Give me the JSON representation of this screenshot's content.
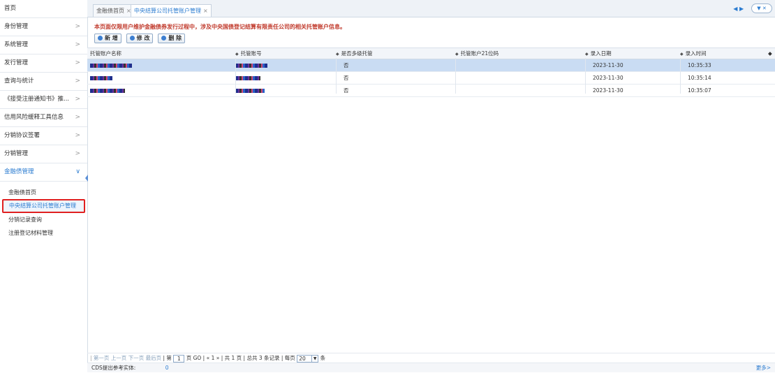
{
  "sidebar": {
    "items": [
      {
        "label": "首页",
        "chevron": ""
      },
      {
        "label": "身份管理",
        "chevron": ">"
      },
      {
        "label": "系统管理",
        "chevron": ">"
      },
      {
        "label": "发行管理",
        "chevron": ">"
      },
      {
        "label": "查询与统计",
        "chevron": ">"
      },
      {
        "label": "《接受注册通知书》推...",
        "chevron": ">"
      },
      {
        "label": "信用风险缓释工具信息",
        "chevron": ">"
      },
      {
        "label": "分销协议签署",
        "chevron": ">"
      },
      {
        "label": "分销管理",
        "chevron": ">"
      },
      {
        "label": "金融债管理",
        "chevron": "∨"
      }
    ],
    "sub_items": [
      {
        "label": "金融债首页"
      },
      {
        "label": "中央结算公司托管账户管理"
      },
      {
        "label": "分销记录查询"
      },
      {
        "label": "注册登记材料管理"
      }
    ]
  },
  "tabs": [
    {
      "label": "金融债首页",
      "close": "×"
    },
    {
      "label": "中央结算公司托管账户管理",
      "close": "×"
    }
  ],
  "tab_nav": {
    "arrows": "◀ ▶",
    "dropdown": "▼ ✕"
  },
  "notice": "本页面仅限用户维护金融债券发行过程中，涉及中央国债登记结算有限责任公司的相关托管账户信息。",
  "toolbar": {
    "add": "新 增",
    "edit": "修 改",
    "delete": "删 除"
  },
  "grid": {
    "sort_icon": "◆",
    "columns": [
      "托管账户名称",
      "托管账号",
      "是否多级托管",
      "托管账户21位码",
      "录入日期",
      "录入时间"
    ],
    "rows": [
      {
        "name": "",
        "account": "",
        "multi": "否",
        "code21": "",
        "date": "2023-11-30",
        "time": "10:35:33",
        "selected": true
      },
      {
        "name": "",
        "account": "",
        "multi": "否",
        "code21": "",
        "date": "2023-11-30",
        "time": "10:35:14",
        "selected": false
      },
      {
        "name": "",
        "account": "",
        "multi": "否",
        "code21": "",
        "date": "2023-11-30",
        "time": "10:35:07",
        "selected": false
      }
    ]
  },
  "pager": {
    "first": "第一页",
    "prev": "上一页",
    "next": "下一页",
    "last": "最后页",
    "page_prefix": "| 第",
    "page_value": "1",
    "page_suffix": "页 GO |",
    "nav": "« 1 »",
    "summary": "| 共 1 页 | 总共 3 条记录 | 每页",
    "page_size": "20",
    "unit": "条"
  },
  "status": {
    "label": "CDS提出参考实体:",
    "value": "0",
    "more": "更多>"
  }
}
